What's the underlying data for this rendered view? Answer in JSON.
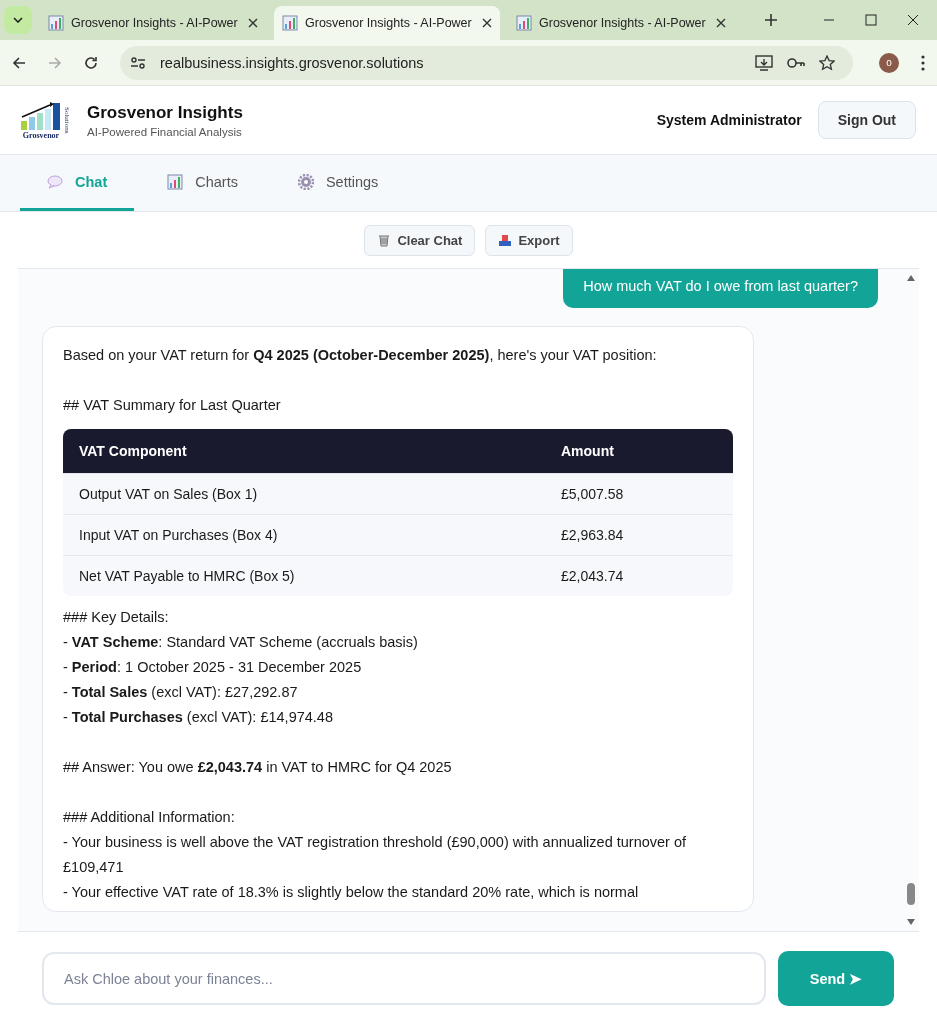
{
  "browser": {
    "tabs": [
      {
        "title": "Grosvenor Insights - AI-Power",
        "selected": false
      },
      {
        "title": "Grosvenor Insights - AI-Power",
        "selected": true
      },
      {
        "title": "Grosvenor Insights - AI-Power",
        "selected": false
      }
    ],
    "url": "realbusiness.insights.grosvenor.solutions",
    "profile": "o"
  },
  "header": {
    "logo_text": "Grosvenor",
    "logo_side_text": "Solutions",
    "title": "Grosvenor Insights",
    "subtitle": "AI-Powered Financial Analysis",
    "user": "System Administrator",
    "sign_out": "Sign Out"
  },
  "nav_tabs": [
    {
      "label": "Chat",
      "selected": true
    },
    {
      "label": "Charts",
      "selected": false
    },
    {
      "label": "Settings",
      "selected": false
    }
  ],
  "toolbar": [
    {
      "label": "Clear Chat"
    },
    {
      "label": "Export"
    }
  ],
  "messages": [
    {
      "kind": "user",
      "text": "How much VAT do I owe from last quarter?"
    },
    {
      "kind": "assistant",
      "blocks": [
        {
          "kind": "para",
          "lines": [
            "Based on your VAT return for **Q4 2025 (October-December 2025)**, here's your VAT position:"
          ]
        },
        {
          "kind": "para",
          "lines": [
            "## VAT Summary for Last Quarter"
          ]
        },
        {
          "kind": "table",
          "columns": [
            "VAT Component",
            "Amount"
          ],
          "rows": [
            [
              "Output VAT on Sales (Box 1)",
              "£5,007.58"
            ],
            [
              "Input VAT on Purchases (Box 4)",
              "£2,963.84"
            ],
            [
              "Net VAT Payable to HMRC (Box 5)",
              "£2,043.74"
            ]
          ]
        },
        {
          "kind": "para",
          "lines": [
            "### Key Details:",
            "- **VAT Scheme**: Standard VAT Scheme (accruals basis)",
            "- **Period**: 1 October 2025 - 31 December 2025",
            "- **Total Sales** (excl VAT): £27,292.87",
            "- **Total Purchases** (excl VAT): £14,974.48"
          ]
        },
        {
          "kind": "para",
          "lines": [
            "## Answer: You owe **£2,043.74** in VAT to HMRC for Q4 2025"
          ]
        },
        {
          "kind": "para",
          "lines": [
            "### Additional Information:",
            "- Your business is well above the VAT registration threshold (£90,000) with annualized turnover of £109,471",
            "- Your effective VAT rate of 18.3% is slightly below the standard 20% rate, which is normal"
          ]
        }
      ]
    }
  ],
  "composer": {
    "placeholder": "Ask Chloe about your finances...",
    "send": "Send ➤"
  }
}
